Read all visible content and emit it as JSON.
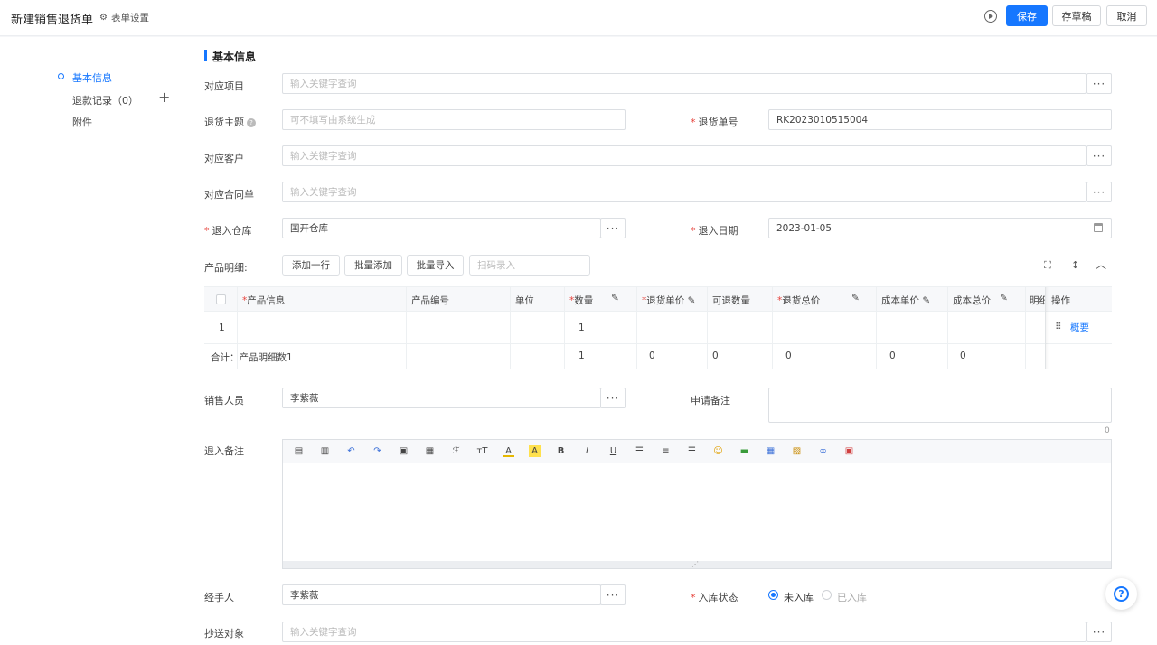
{
  "header": {
    "title": "新建销售退货单",
    "form_settings": "表单设置",
    "save": "保存",
    "draft": "存草稿",
    "cancel": "取消"
  },
  "sidebar": {
    "items": [
      {
        "label": "基本信息",
        "active": true
      },
      {
        "label": "退款记录（0）"
      },
      {
        "label": "附件"
      }
    ]
  },
  "section": {
    "title": "基本信息"
  },
  "form": {
    "project": {
      "label": "对应项目",
      "placeholder": "输入关键字查询"
    },
    "subject": {
      "label": "退货主题",
      "placeholder": "可不填写由系统生成"
    },
    "return_no": {
      "label": "退货单号",
      "value": "RK2023010515004"
    },
    "customer": {
      "label": "对应客户",
      "placeholder": "输入关键字查询"
    },
    "contract": {
      "label": "对应合同单",
      "placeholder": "输入关键字查询"
    },
    "warehouse": {
      "label": "退入仓库",
      "value": "国开仓库"
    },
    "return_date": {
      "label": "退入日期",
      "value": "2023-01-05"
    },
    "product_detail_label": "产品明细:",
    "add_row": "添加一行",
    "batch_add": "批量添加",
    "batch_import": "批量导入",
    "scan_placeholder": "扫码录入",
    "salesperson": {
      "label": "销售人员",
      "value": "李紫薇"
    },
    "apply_note": {
      "label": "申请备注",
      "count": "0"
    },
    "return_note": {
      "label": "退入备注"
    },
    "handler": {
      "label": "经手人",
      "value": "李紫薇"
    },
    "stock_status": {
      "label": "入库状态",
      "options": [
        "未入库",
        "已入库"
      ],
      "selected": "未入库"
    },
    "cc": {
      "label": "抄送对象",
      "placeholder": "输入关键字查询"
    }
  },
  "table": {
    "headers": [
      "产品信息",
      "产品编号",
      "单位",
      "数量",
      "退货单价",
      "可退数量",
      "退货总价",
      "成本单价",
      "成本总价",
      "明细",
      "操作"
    ],
    "rows": [
      {
        "index": "1",
        "qty": "1",
        "action": "概要"
      }
    ],
    "summary": {
      "label": "合计：产品明细数1",
      "qty": "1",
      "unit_price": "0",
      "returnable": "0",
      "total": "0",
      "cost_unit": "0",
      "cost_total": "0"
    }
  },
  "colors": {
    "accent": "#1677ff",
    "required": "#e6413a"
  }
}
